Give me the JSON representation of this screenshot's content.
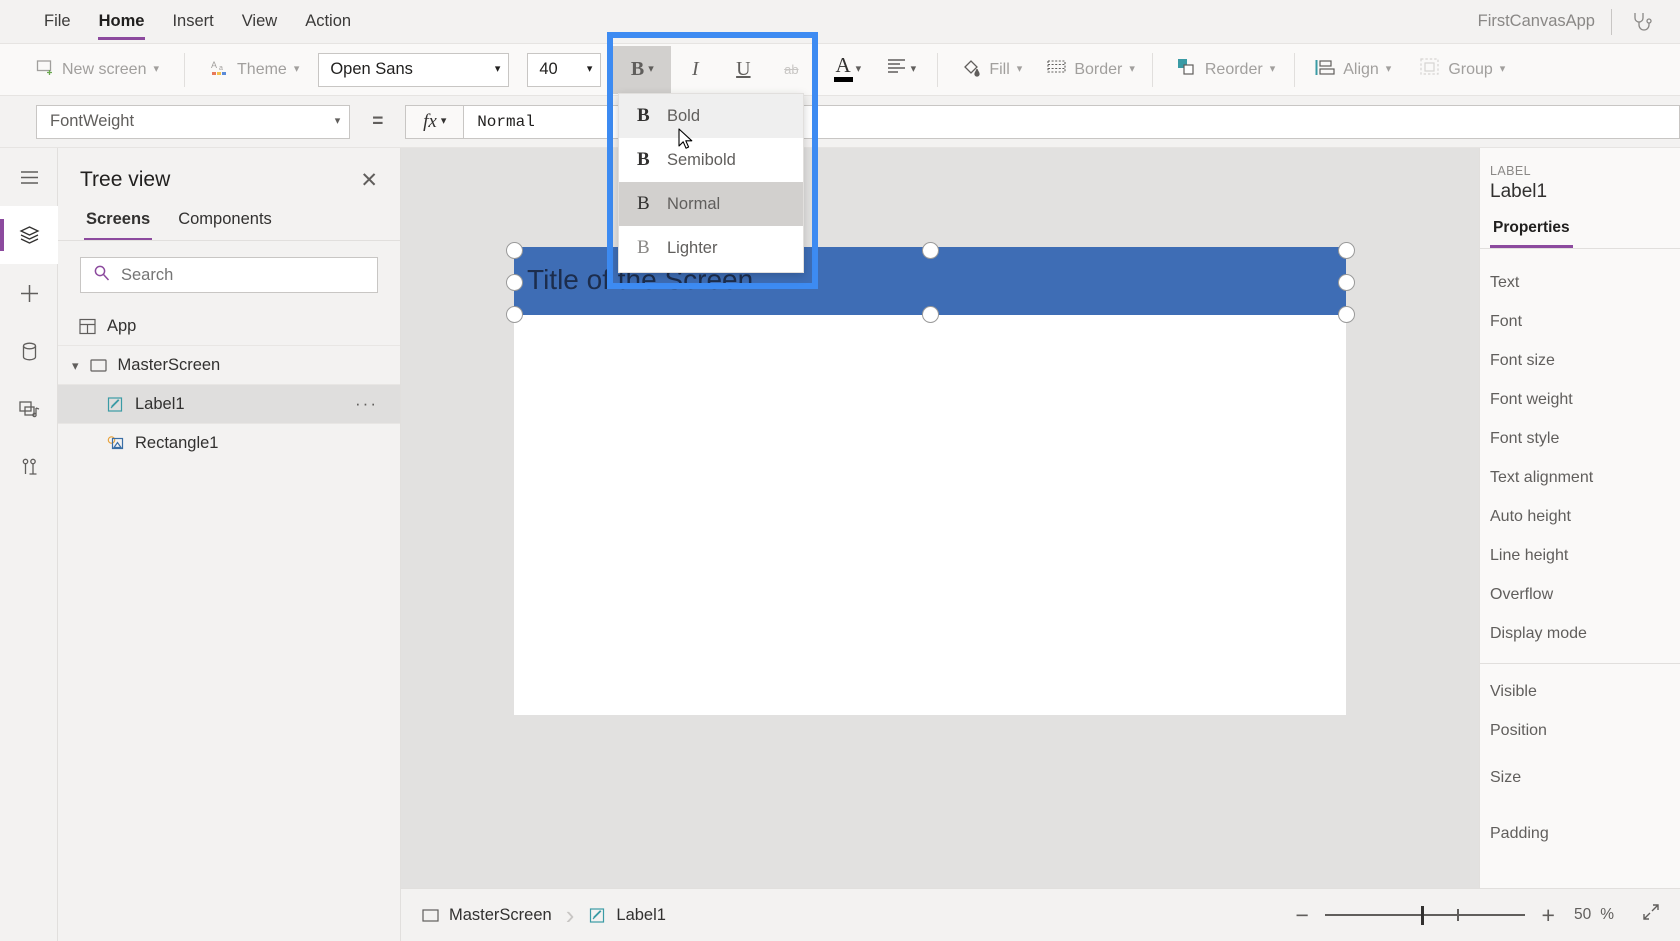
{
  "menubar": {
    "items": [
      {
        "label": "File",
        "active": false
      },
      {
        "label": "Home",
        "active": true
      },
      {
        "label": "Insert",
        "active": false
      },
      {
        "label": "View",
        "active": false
      },
      {
        "label": "Action",
        "active": false
      }
    ],
    "app_title": "FirstCanvasApp",
    "health_icon": "stethoscope-icon"
  },
  "toolbar": {
    "new_screen_label": "New screen",
    "new_screen_icon": "new-screen-icon",
    "theme_label": "Theme",
    "theme_icon": "theme-icon",
    "font_family_value": "Open Sans",
    "font_size_value": "40",
    "bold_glyph": "B",
    "italic_glyph": "I",
    "underline_glyph": "U",
    "strikethrough_glyph": "ab",
    "font_color_glyph": "A",
    "align_icon": "text-align-icon",
    "fill_label": "Fill",
    "fill_icon": "fill-bucket-icon",
    "border_label": "Border",
    "border_icon": "border-icon",
    "reorder_label": "Reorder",
    "reorder_icon": "reorder-icon",
    "align_label": "Align",
    "align_group_icon": "align-objects-icon",
    "group_label": "Group",
    "group_icon": "group-icon"
  },
  "formulabar": {
    "property_value": "FontWeight",
    "equals": "=",
    "fx_label": "fx",
    "formula_value": "Normal"
  },
  "rail": {
    "items": [
      {
        "name": "hamburger-menu-icon",
        "active": false
      },
      {
        "name": "tree-view-icon",
        "active": true
      },
      {
        "name": "insert-plus-icon",
        "active": false
      },
      {
        "name": "data-sources-icon",
        "active": false
      },
      {
        "name": "media-icon",
        "active": false
      },
      {
        "name": "advanced-tools-icon",
        "active": false
      }
    ]
  },
  "treeview": {
    "title": "Tree view",
    "close_icon": "close-icon",
    "tabs": [
      {
        "label": "Screens",
        "active": true
      },
      {
        "label": "Components",
        "active": false
      }
    ],
    "search_placeholder": "Search",
    "search_value": "",
    "search_icon": "search-icon",
    "nodes": [
      {
        "label": "App",
        "icon": "app-icon",
        "indent": 0,
        "selected": false,
        "expander": "",
        "ellipsis": false
      },
      {
        "label": "MasterScreen",
        "icon": "screen-icon",
        "indent": 0,
        "selected": false,
        "expander": "chevron-down-icon",
        "ellipsis": false
      },
      {
        "label": "Label1",
        "icon": "label-icon",
        "indent": 1,
        "selected": true,
        "expander": "",
        "ellipsis": true
      },
      {
        "label": "Rectangle1",
        "icon": "shape-icon",
        "indent": 1,
        "selected": false,
        "expander": "",
        "ellipsis": false
      }
    ],
    "ellipsis_glyph": "…"
  },
  "fontweight_dropdown": {
    "items": [
      {
        "label": "Bold",
        "glyph": "B",
        "state": "hover"
      },
      {
        "label": "Semibold",
        "glyph": "B",
        "state": "normal"
      },
      {
        "label": "Normal",
        "glyph": "B",
        "state": "selected"
      },
      {
        "label": "Lighter",
        "glyph": "B",
        "state": "normal"
      }
    ],
    "highlight_color": "#3d8bf2"
  },
  "canvas": {
    "label_text": "Title of the Screen",
    "header_fill": "#3e6db5",
    "label_color": "#1c2d4d",
    "background": "#e2e1e0"
  },
  "properties": {
    "kind": "LABEL",
    "name": "Label1",
    "tabs": [
      {
        "label": "Properties",
        "active": true
      }
    ],
    "group1": [
      "Text",
      "Font",
      "Font size",
      "Font weight",
      "Font style",
      "Text alignment",
      "Auto height",
      "Line height",
      "Overflow",
      "Display mode"
    ],
    "group2": [
      "Visible",
      "Position",
      "Size",
      "Padding"
    ]
  },
  "bottombar": {
    "breadcrumb": [
      {
        "label": "MasterScreen",
        "icon": "screen-icon"
      },
      {
        "label": "Label1",
        "icon": "label-icon"
      }
    ],
    "zoom_minus": "−",
    "zoom_plus": "+",
    "zoom_value": "50",
    "zoom_unit": "%",
    "expand_icon": "expand-canvas-icon"
  }
}
